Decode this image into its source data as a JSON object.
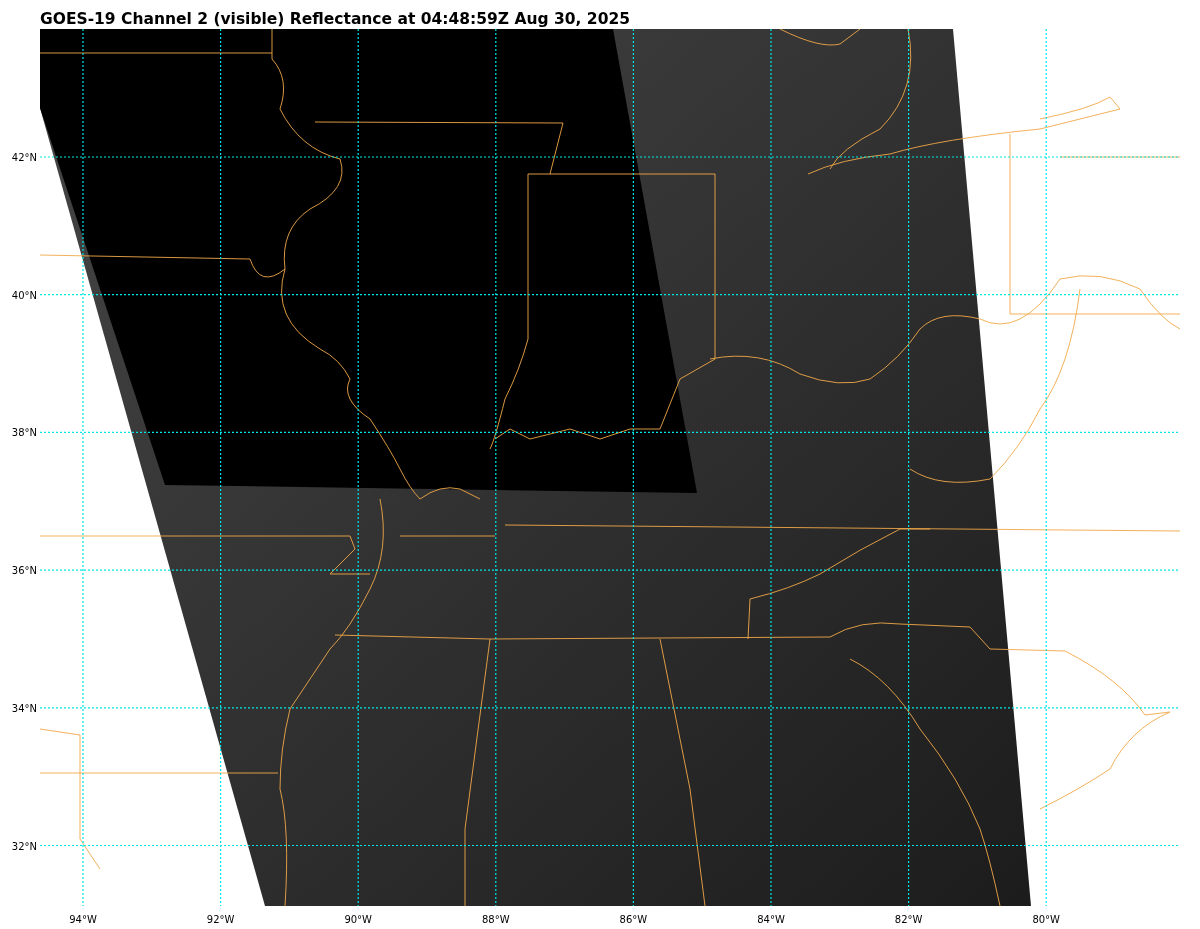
{
  "title": "GOES-19 Channel 2 (visible) Reflectance at 04:48:59Z Aug 30, 2025",
  "latitude_labels": [
    "42°N",
    "40°N",
    "38°N",
    "36°N",
    "34°N",
    "32°N"
  ],
  "longitude_labels": [
    "94°W",
    "92°W",
    "90°W",
    "88°W",
    "86°W",
    "84°W",
    "82°W",
    "80°W"
  ]
}
